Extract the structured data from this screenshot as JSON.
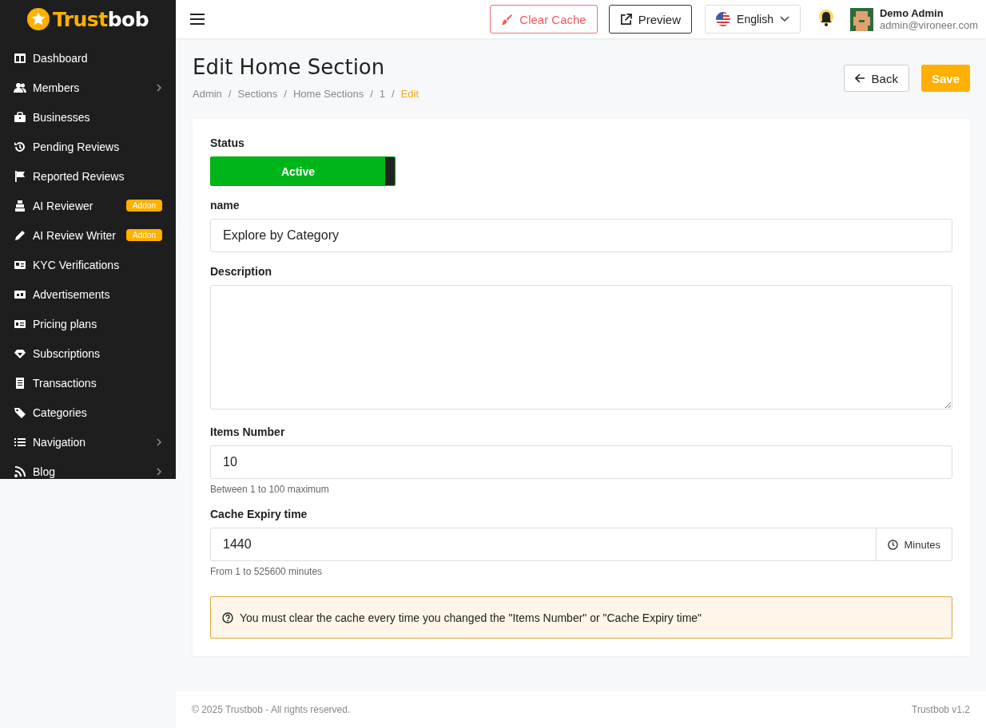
{
  "logo": {
    "accent": "Trust",
    "rest": "bob"
  },
  "sidebar": {
    "items": [
      {
        "label": "Dashboard",
        "submenu": false
      },
      {
        "label": "Members",
        "submenu": true
      },
      {
        "label": "Businesses",
        "submenu": false
      },
      {
        "label": "Pending Reviews",
        "submenu": false
      },
      {
        "label": "Reported Reviews",
        "submenu": false
      },
      {
        "label": "AI Reviewer",
        "submenu": false,
        "badge": "Addon"
      },
      {
        "label": "AI Review Writer",
        "submenu": false,
        "badge": "Addon"
      },
      {
        "label": "KYC Verifications",
        "submenu": false
      },
      {
        "label": "Advertisements",
        "submenu": false
      },
      {
        "label": "Pricing plans",
        "submenu": false
      },
      {
        "label": "Subscriptions",
        "submenu": false
      },
      {
        "label": "Transactions",
        "submenu": false
      },
      {
        "label": "Categories",
        "submenu": false
      },
      {
        "label": "Navigation",
        "submenu": true
      },
      {
        "label": "Blog",
        "submenu": true
      }
    ]
  },
  "topbar": {
    "clear_cache": "Clear Cache",
    "preview": "Preview",
    "language": "English",
    "user": {
      "name": "Demo Admin",
      "email": "admin@vironeer.com"
    }
  },
  "page": {
    "title": "Edit Home Section",
    "breadcrumb_separator": "/",
    "breadcrumb": [
      {
        "label": "Admin",
        "selected": false
      },
      {
        "label": "Sections",
        "selected": false
      },
      {
        "label": "Home Sections",
        "selected": false
      },
      {
        "label": "1",
        "selected": false
      },
      {
        "label": "Edit",
        "selected": true
      }
    ],
    "back": "Back",
    "save": "Save"
  },
  "form": {
    "status": {
      "label": "Status",
      "text": "Active",
      "on": true
    },
    "name": {
      "label": "name",
      "value": "Explore by Category"
    },
    "description": {
      "label": "Description"
    },
    "items_number": {
      "label": "Items Number",
      "value": "10",
      "hint": "Between 1 to 100 maximum"
    },
    "cache_expiry": {
      "label": "Cache Expiry time",
      "value": "1440",
      "unit": "Minutes",
      "hint": "From 1 to 525600 minutes"
    },
    "notice": "You must clear the cache every time you changed the \"Items Number\" or \"Cache Expiry time\""
  },
  "footer": {
    "copyright": "© 2025 Trustbob - All rights reserved.",
    "version": "Trustbob v1.2"
  }
}
